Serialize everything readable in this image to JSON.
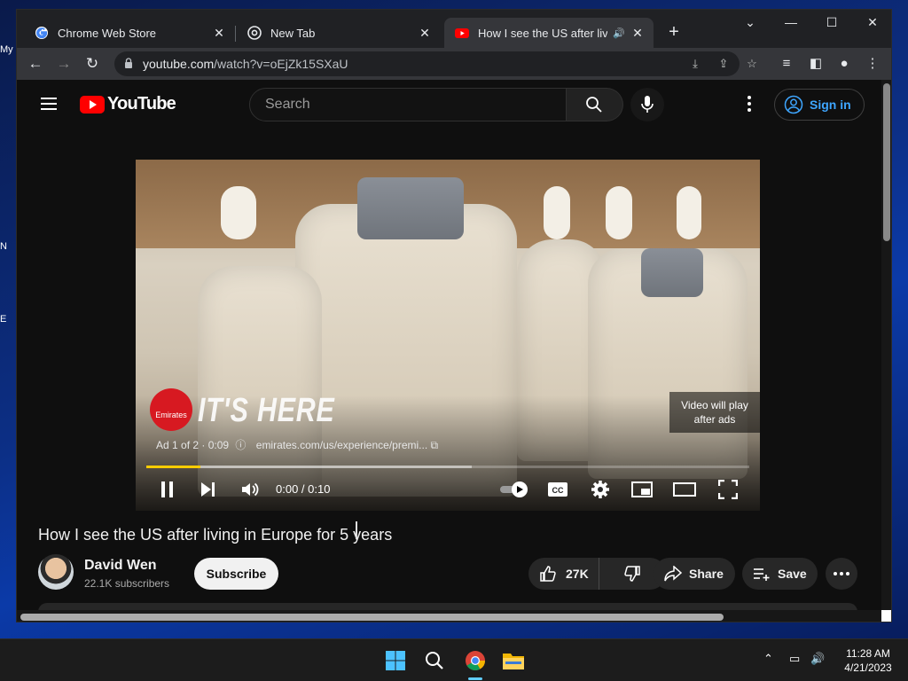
{
  "desktop": {
    "labels": [
      "My",
      "N",
      "E"
    ]
  },
  "browser": {
    "tabs": [
      {
        "label": "Chrome Web Store",
        "icon": "google-icon",
        "active": false
      },
      {
        "label": "New Tab",
        "icon": "chrome-icon",
        "active": false
      },
      {
        "label": "How I see the US after living",
        "icon": "youtube-icon",
        "active": true,
        "audio": true
      }
    ],
    "url_host": "youtube.com",
    "url_path": "/watch?v=oEjZk15SXaU",
    "new_tab_glyph": "+",
    "window_controls": {
      "tab_search": "⌄",
      "minimize": "—",
      "maximize": "☐",
      "close": "✕"
    }
  },
  "youtube": {
    "logo_text": "YouTube",
    "search_placeholder": "Search",
    "sign_in": "Sign in",
    "player": {
      "ad_brand": "Emirates",
      "ad_slogan": "IT'S HERE",
      "ad_counter": "Ad 1 of 2 · 0:09",
      "ad_url": "emirates.com/us/experience/premi...",
      "countdown_line1": "Video will play",
      "countdown_line2": "after ads",
      "time": "0:00 / 0:10",
      "progress_fraction": 0.09,
      "buffered_fraction": 0.54
    },
    "video": {
      "title": "How I see the US after living in Europe for 5 years",
      "channel": "David Wen",
      "subscribers": "22.1K subscribers",
      "subscribe_label": "Subscribe",
      "likes": "27K",
      "share_label": "Share",
      "save_label": "Save"
    }
  },
  "taskbar": {
    "time": "11:28 AM",
    "date": "4/21/2023"
  },
  "colors": {
    "yt_red": "#ff0000",
    "link_blue": "#3ea6ff",
    "ad_yellow": "#ffcc00",
    "emirates_red": "#d71921"
  }
}
